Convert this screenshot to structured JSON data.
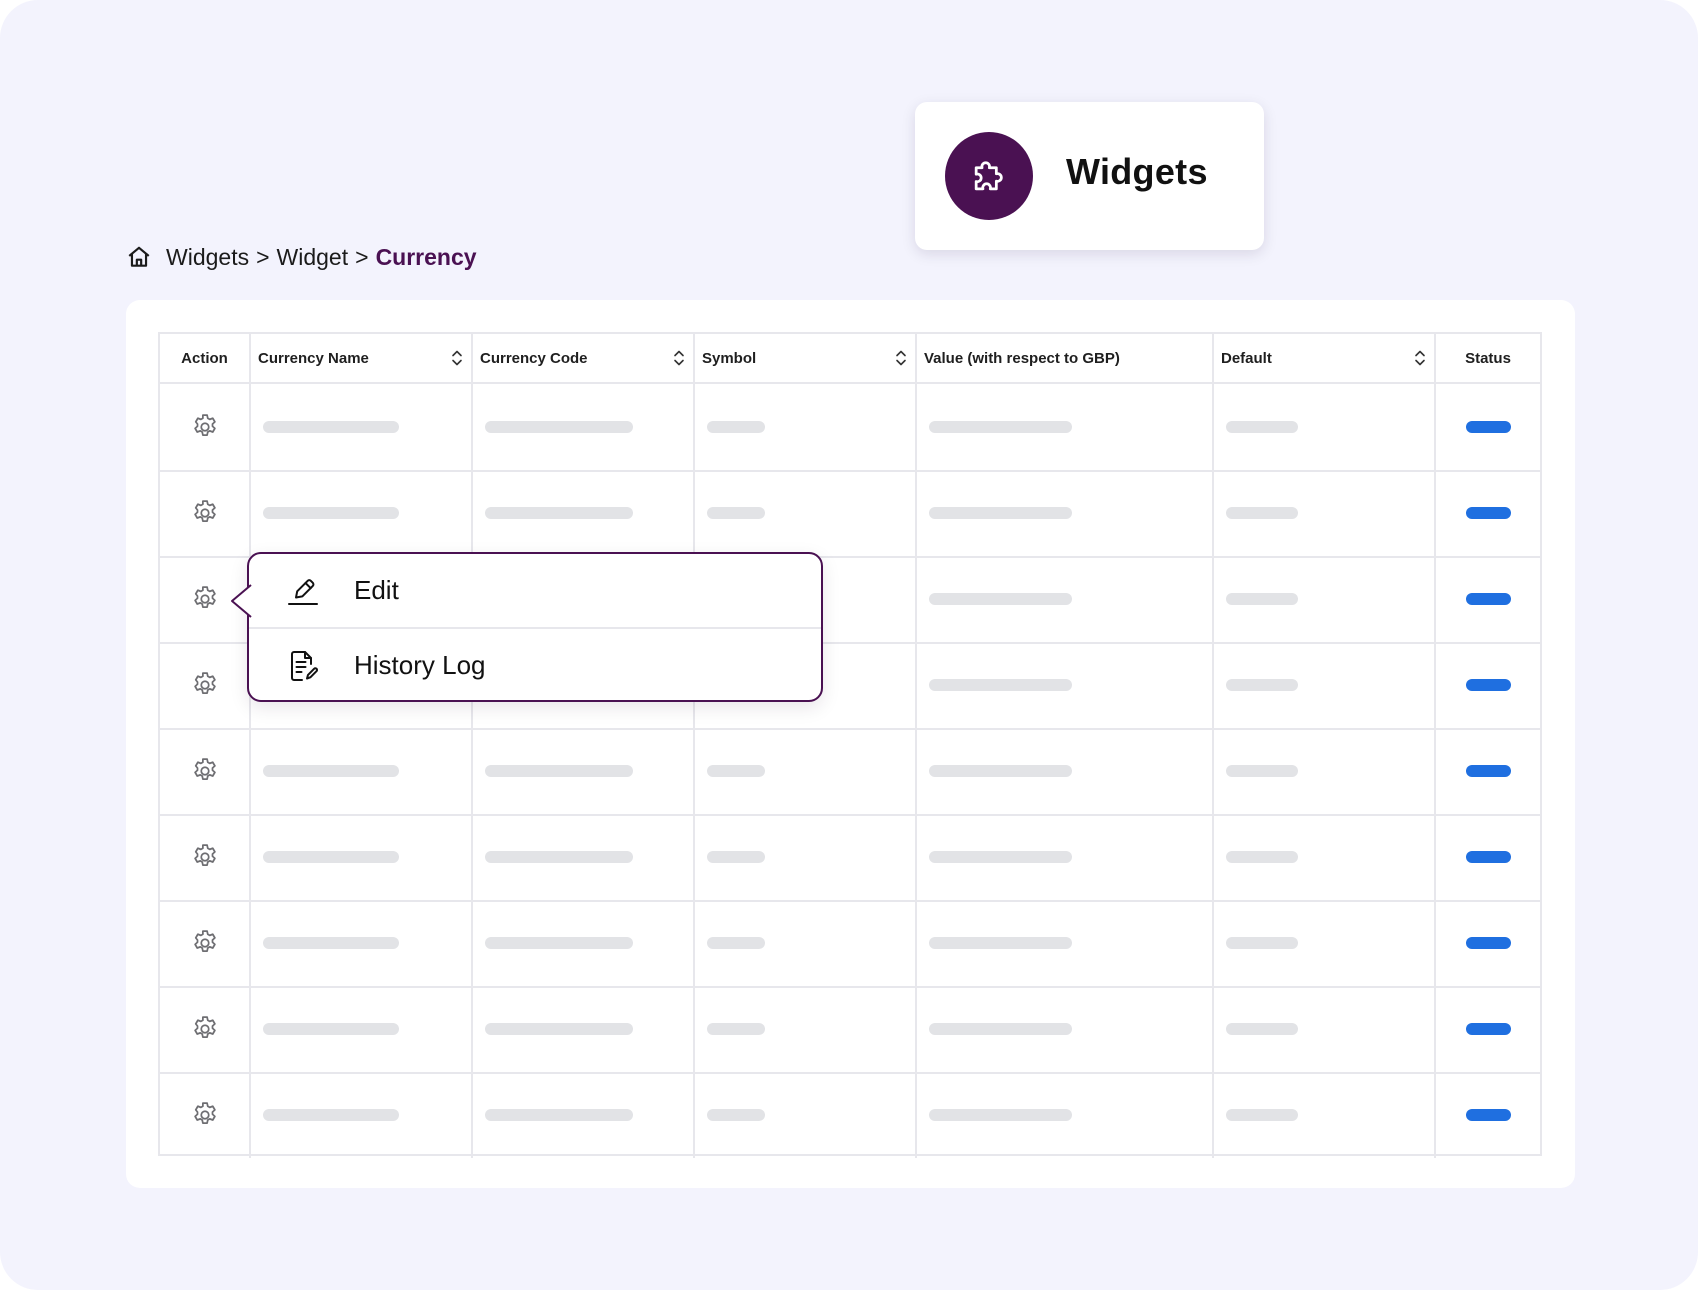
{
  "header": {
    "title": "Widgets",
    "icon": "puzzle-icon",
    "badge_color": "#4a1152"
  },
  "breadcrumb": {
    "home_icon": "home-icon",
    "items": [
      "Widgets",
      "Widget",
      "Currency"
    ],
    "separator": ">"
  },
  "table": {
    "columns": [
      {
        "label": "Action",
        "sortable": false
      },
      {
        "label": "Currency Name",
        "sortable": true
      },
      {
        "label": "Currency Code",
        "sortable": true
      },
      {
        "label": "Symbol",
        "sortable": true
      },
      {
        "label": "Value (with respect to GBP)",
        "sortable": false
      },
      {
        "label": "Default",
        "sortable": true
      },
      {
        "label": "Status",
        "sortable": false
      }
    ],
    "row_count": 9,
    "row_action_icon": "gear-icon",
    "status_color": "#1f6fe0"
  },
  "action_menu": {
    "open_on_row": 3,
    "items": [
      {
        "label": "Edit",
        "icon": "edit-icon"
      },
      {
        "label": "History Log",
        "icon": "history-log-icon"
      }
    ],
    "border_color": "#4a1152"
  }
}
